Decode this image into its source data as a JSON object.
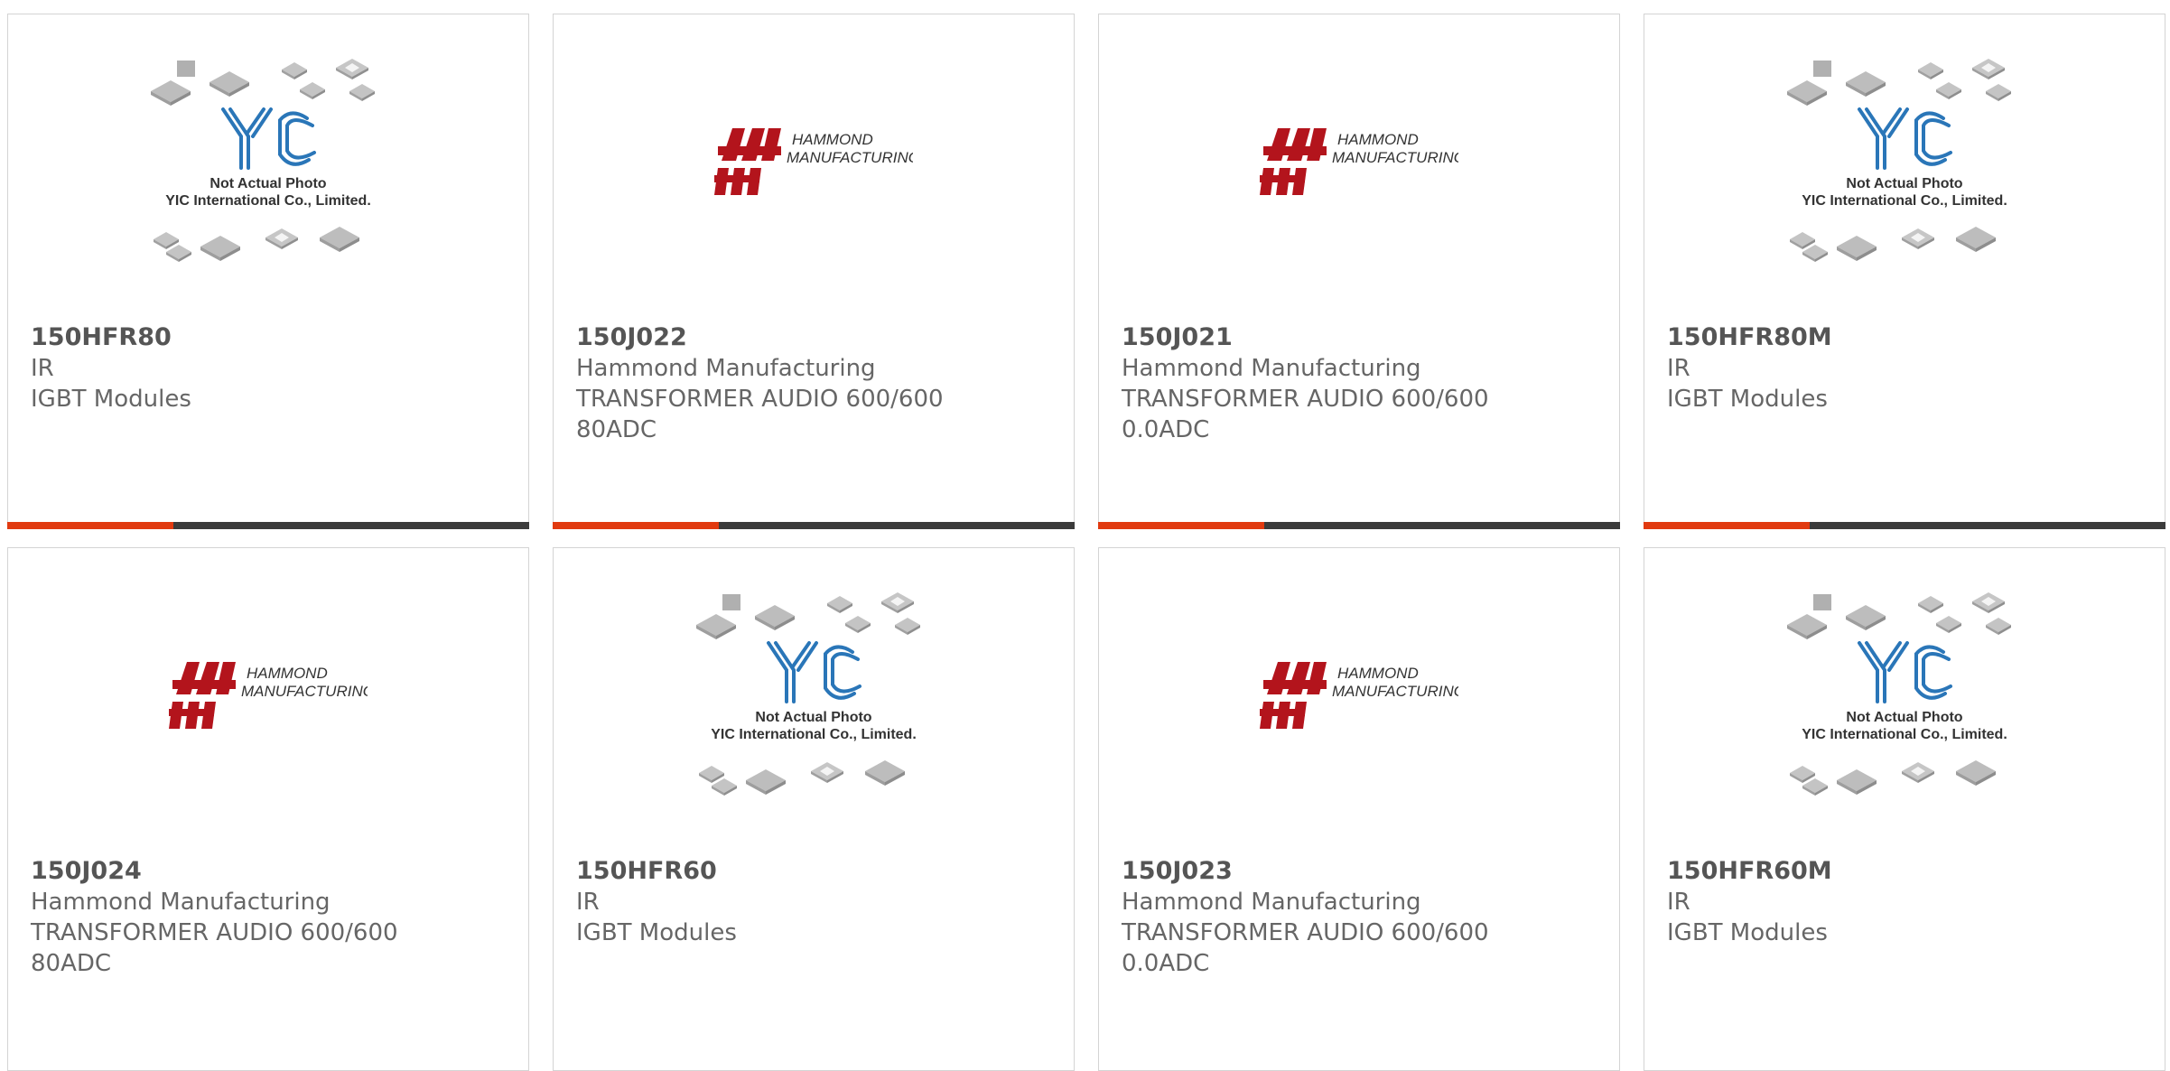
{
  "colors": {
    "accent": "#e13a10",
    "bar_dark": "#3b3b3b",
    "hammond_red": "#b3141c",
    "yic_blue": "#2a76b8"
  },
  "placeholder": {
    "line1": "Not Actual Photo",
    "line2": "YIC International Co., Limited."
  },
  "logo": {
    "line1": "HAMMOND",
    "line2": "MANUFACTURING."
  },
  "products": [
    {
      "part": "150HFR80",
      "mfr": "IR",
      "desc": "IGBT Modules",
      "extra": "",
      "image": "yic-placeholder"
    },
    {
      "part": "150J022",
      "mfr": "Hammond Manufacturing",
      "desc": "TRANSFORMER AUDIO 600/600",
      "extra": "80ADC",
      "image": "hammond-logo"
    },
    {
      "part": "150J021",
      "mfr": "Hammond Manufacturing",
      "desc": "TRANSFORMER AUDIO 600/600",
      "extra": "0.0ADC",
      "image": "hammond-logo"
    },
    {
      "part": "150HFR80M",
      "mfr": "IR",
      "desc": "IGBT Modules",
      "extra": "",
      "image": "yic-placeholder"
    },
    {
      "part": "150J024",
      "mfr": "Hammond Manufacturing",
      "desc": "TRANSFORMER AUDIO 600/600",
      "extra": "80ADC",
      "image": "hammond-logo"
    },
    {
      "part": "150HFR60",
      "mfr": "IR",
      "desc": "IGBT Modules",
      "extra": "",
      "image": "yic-placeholder"
    },
    {
      "part": "150J023",
      "mfr": "Hammond Manufacturing",
      "desc": "TRANSFORMER AUDIO 600/600",
      "extra": "0.0ADC",
      "image": "hammond-logo"
    },
    {
      "part": "150HFR60M",
      "mfr": "IR",
      "desc": "IGBT Modules",
      "extra": "",
      "image": "yic-placeholder"
    }
  ]
}
